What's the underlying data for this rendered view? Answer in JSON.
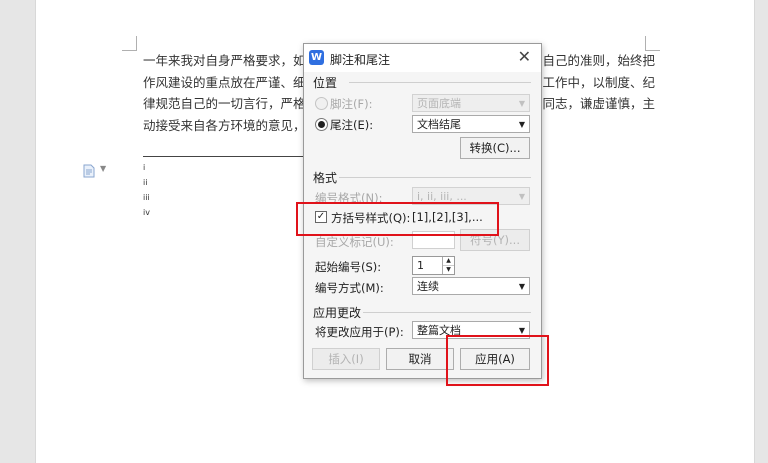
{
  "document": {
    "lines": [
      {
        "left": "一年来我对自身严格要求，如",
        "right": "自己的准则，始终把"
      },
      {
        "left": "作风建设的重点放在严谨、细",
        "right": "工作中，以制度、纪"
      },
      {
        "left": "律规范自己的一切言行，严格",
        "right": "同志，谦虚谨慎，主"
      },
      {
        "left": "动接受来自各方环境的意见，",
        "right": ""
      }
    ],
    "endnote_markers": [
      "i",
      "ii",
      "iii",
      "iv"
    ]
  },
  "dialog": {
    "title": "脚注和尾注",
    "app_icon_letter": "W",
    "location_section": "位置",
    "footnote_label": "脚注(F):",
    "footnote_position": "页面底端",
    "endnote_label": "尾注(E):",
    "endnote_position": "文档结尾",
    "convert_button": "转换(C)...",
    "format_section": "格式",
    "number_format_label": "编号格式(N):",
    "number_format_value": "i, ii, iii, ...",
    "bracket_style_label": "方括号样式(Q):",
    "bracket_style_sample": "[1],[2],[3],...",
    "custom_mark_label": "自定义标记(U):",
    "symbol_button": "符号(Y)...",
    "start_at_label": "起始编号(S):",
    "start_at_value": "1",
    "numbering_label": "编号方式(M):",
    "numbering_value": "连续",
    "apply_section": "应用更改",
    "apply_to_label": "将更改应用于(P):",
    "apply_to_value": "整篇文档",
    "insert_button": "插入(I)",
    "cancel_button": "取消",
    "apply_button": "应用(A)",
    "checkbox_mark": "✓"
  },
  "colors": {
    "highlight": "#e0121a",
    "app_icon": "#2f6fe0"
  }
}
